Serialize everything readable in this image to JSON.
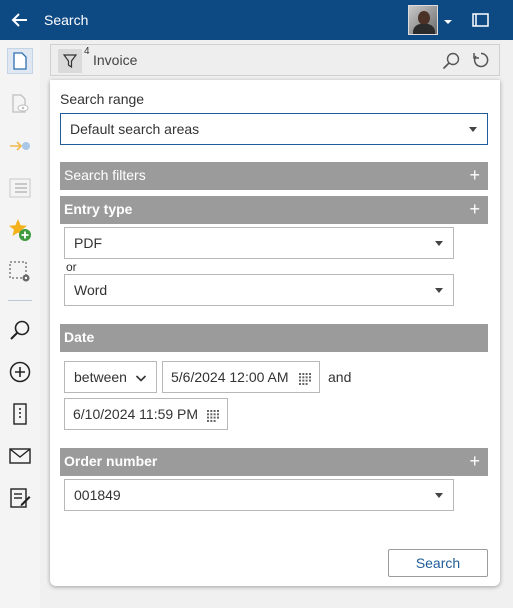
{
  "header": {
    "title": "Search"
  },
  "searchbar": {
    "filter_count": "4",
    "label": "Invoice"
  },
  "search_range": {
    "label": "Search range",
    "value": "Default search areas"
  },
  "sections": {
    "search_filters": "Search filters",
    "entry_type": "Entry type",
    "date": "Date",
    "order_number": "Order number"
  },
  "entry_type": {
    "first": "PDF",
    "or_label": "or",
    "second": "Word"
  },
  "date": {
    "operator": "between",
    "start": "5/6/2024 12:00 AM",
    "and_label": "and",
    "end": "6/10/2024 11:59 PM"
  },
  "order_number": {
    "value": "001849"
  },
  "actions": {
    "search_label": "Search"
  },
  "colors": {
    "topbar": "#0d4a84",
    "section": "#9b9b9b",
    "accent": "#1f5c99"
  }
}
